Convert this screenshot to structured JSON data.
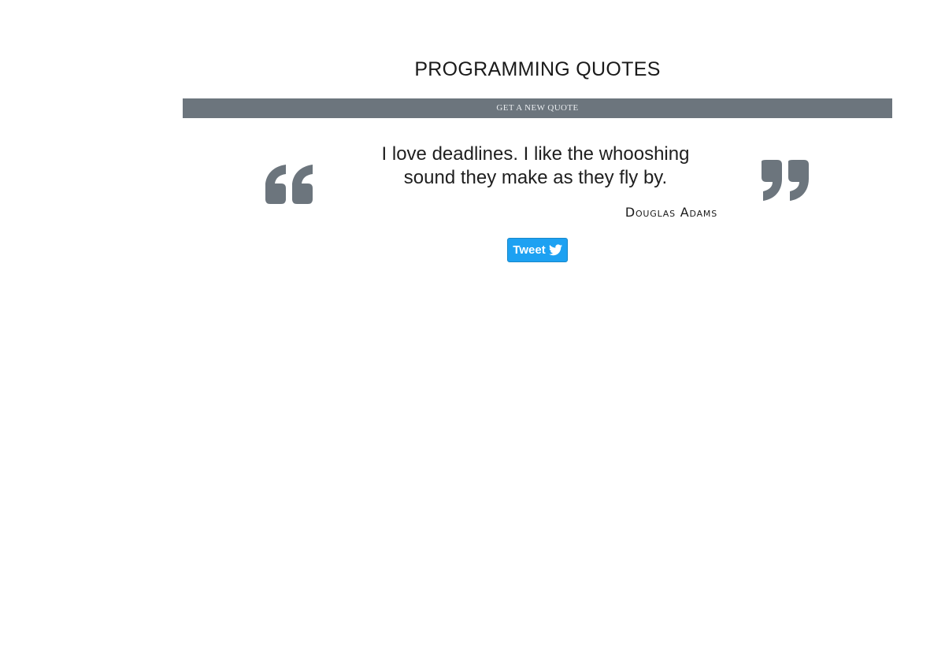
{
  "header": {
    "title": "PROGRAMMING QUOTES"
  },
  "controls": {
    "new_quote_label": "GET A NEW QUOTE",
    "tweet_label": "Tweet"
  },
  "quote": {
    "text": "I love deadlines. I like the whooshing sound they make as they fly by.",
    "author": "Douglas Adams"
  },
  "icons": {
    "open_quote": "quote-left-icon",
    "close_quote": "quote-right-icon",
    "twitter": "twitter-icon"
  },
  "colors": {
    "bar": "#6c757d",
    "quote_marks": "#6c757d",
    "tweet_button": "#1da1f2"
  }
}
